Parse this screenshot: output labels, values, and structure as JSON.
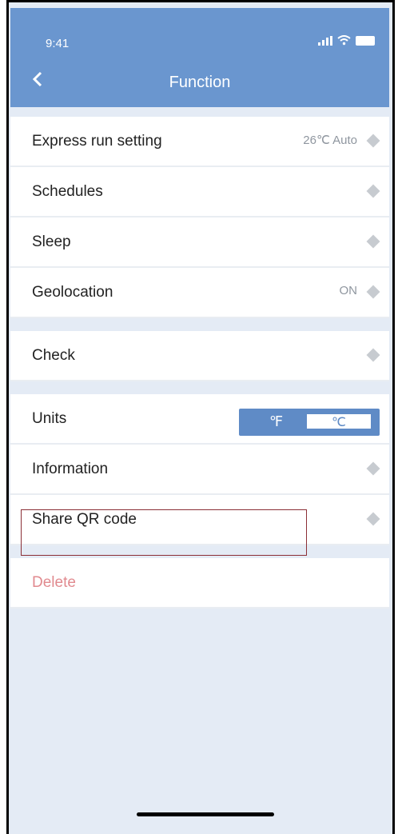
{
  "status_bar": {
    "time": "9:41"
  },
  "header": {
    "title": "Function"
  },
  "rows": [
    {
      "label": "Express run setting",
      "value": "26℃ Auto"
    },
    {
      "label": "Schedules",
      "value": ""
    },
    {
      "label": "Sleep",
      "value": ""
    },
    {
      "label": "Geolocation",
      "value": "ON"
    }
  ],
  "check": {
    "label": "Check"
  },
  "units": {
    "label": "Units",
    "f": "℉",
    "c": "℃"
  },
  "information": {
    "label": "Information"
  },
  "share_qr": {
    "label": "Share QR code"
  },
  "delete": {
    "label": "Delete"
  }
}
